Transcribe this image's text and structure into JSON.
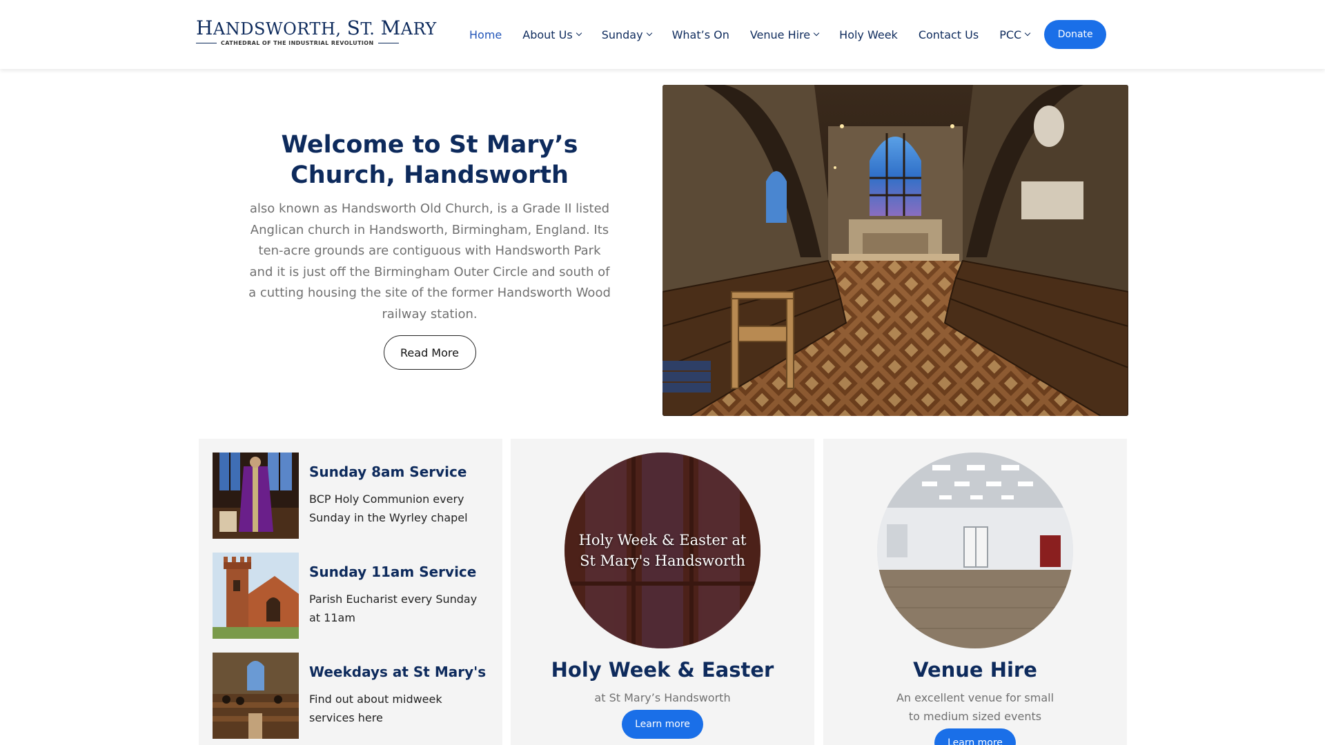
{
  "header": {
    "logo": {
      "title_first_letter": "H",
      "title_rest": "ANDSWORTH, ",
      "title_second_letters": "S",
      "title_second_rest": "T. ",
      "title_third_letter": "M",
      "title_third_rest": "ARY",
      "subtitle": "CATHEDRAL OF THE INDUSTRIAL REVOLUTION"
    },
    "nav": [
      {
        "label": "Home",
        "active": true,
        "dropdown": false
      },
      {
        "label": "About Us",
        "active": false,
        "dropdown": true
      },
      {
        "label": "Sunday",
        "active": false,
        "dropdown": true
      },
      {
        "label": "What’s On",
        "active": false,
        "dropdown": false
      },
      {
        "label": "Venue Hire",
        "active": false,
        "dropdown": true
      },
      {
        "label": "Holy Week",
        "active": false,
        "dropdown": false
      },
      {
        "label": "Contact Us",
        "active": false,
        "dropdown": false
      },
      {
        "label": "PCC",
        "active": false,
        "dropdown": true
      }
    ],
    "donate_label": "Donate"
  },
  "hero": {
    "title": "Welcome to St Mary’s Church, Handsworth",
    "description": "also known as Handsworth Old Church, is a Grade II listed Anglican church in Handsworth, Birmingham, England. Its ten-acre grounds are contiguous with Handsworth Park and it is just off the Birmingham Outer Circle and south of a cutting housing the site of the former Handsworth Wood railway station.",
    "read_more_label": "Read More"
  },
  "services": [
    {
      "title": "Sunday 8am Service",
      "description": "BCP Holy Communion every Sunday in the Wyrley chapel"
    },
    {
      "title": "Sunday 11am Service",
      "description": "Parish Eucharist every Sunday at 11am"
    },
    {
      "title": "Weekdays at St Mary's",
      "description": "Find out about midweek services here"
    }
  ],
  "holy_week": {
    "image_text_line1": "Holy Week & Easter at",
    "image_text_line2": "St Mary's Handsworth",
    "title": "Holy Week & Easter",
    "description": "at St Mary’s Handsworth",
    "button_label": "Learn more"
  },
  "venue": {
    "title": "Venue Hire",
    "description": "An excellent venue for small to medium sized events",
    "button_label": "Learn more"
  },
  "colors": {
    "navy": "#0d2a5c",
    "accent_blue": "#1a6fe8",
    "active_link": "#2255b8",
    "card_bg": "#f4f4f4",
    "muted_text": "#707070"
  }
}
